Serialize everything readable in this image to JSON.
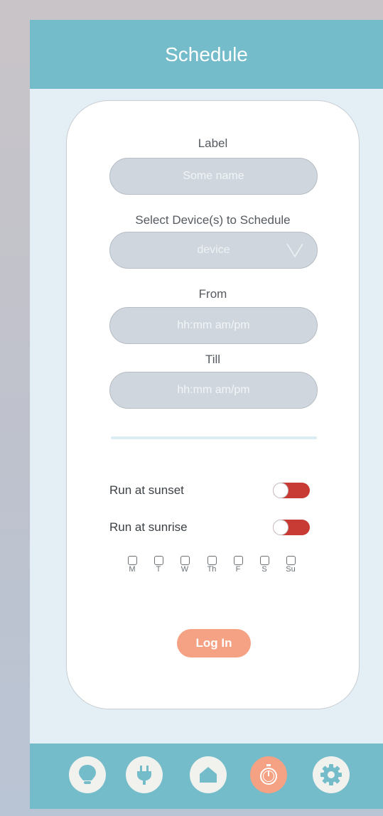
{
  "header": {
    "title": "Schedule"
  },
  "form": {
    "label_title": "Label",
    "label_placeholder": "Some name",
    "device_title": "Select Device(s) to Schedule",
    "device_value": "device",
    "from_title": "From",
    "from_placeholder": "hh:mm am/pm",
    "till_title": "Till",
    "till_placeholder": "hh:mm am/pm"
  },
  "toggles": [
    {
      "label": "Run at sunset",
      "on": false
    },
    {
      "label": "Run at sunrise",
      "on": false
    }
  ],
  "days": [
    "M",
    "T",
    "W",
    "Th",
    "F",
    "S",
    "Su"
  ],
  "login_button": "Log In",
  "nav": [
    {
      "icon": "lightbulb-icon"
    },
    {
      "icon": "plug-icon"
    },
    {
      "icon": "home-icon"
    },
    {
      "icon": "stopwatch-icon",
      "active": true
    },
    {
      "icon": "gear-icon"
    }
  ],
  "colors": {
    "header": "#74bcca",
    "background": "#e3eef5",
    "field": "#cfd6dd",
    "toggle_track": "#c83a34",
    "accent": "#f4a184",
    "nav_icon": "#74bcca"
  }
}
